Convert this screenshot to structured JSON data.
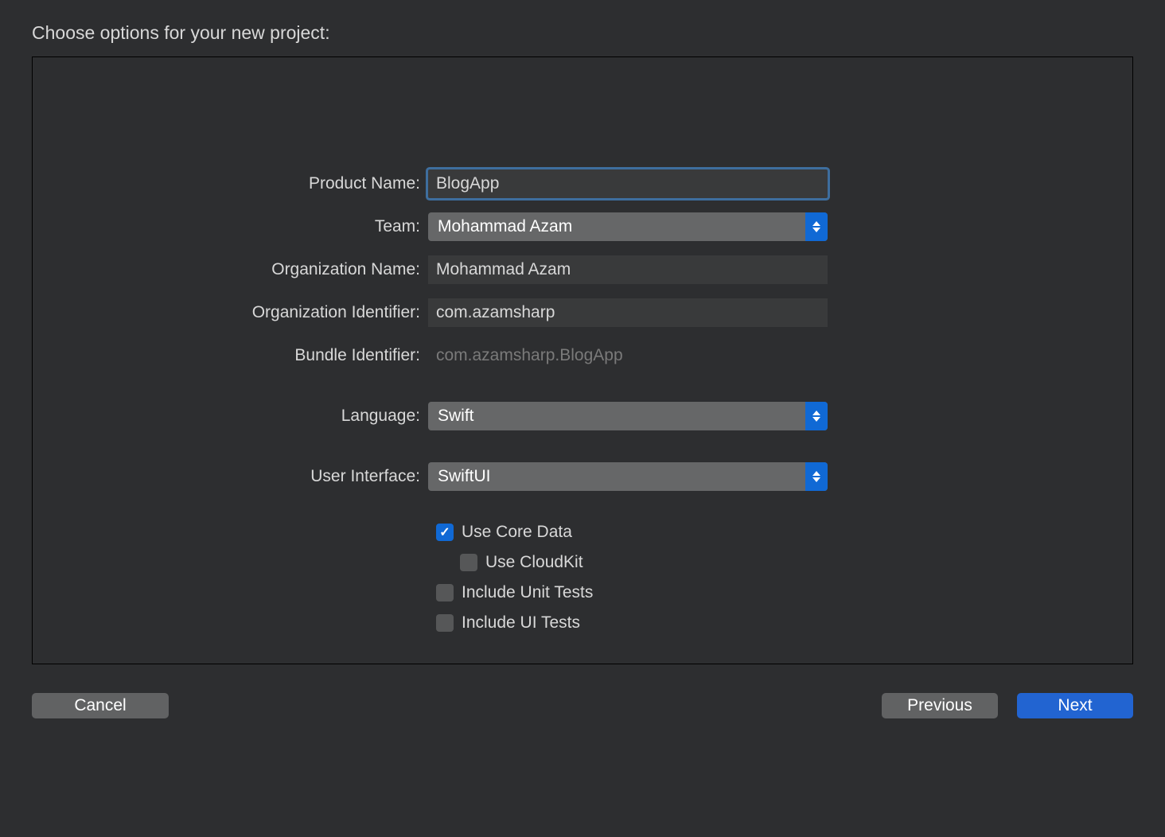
{
  "dialog": {
    "title": "Choose options for your new project:",
    "fields": {
      "productName": {
        "label": "Product Name:",
        "value": "BlogApp"
      },
      "team": {
        "label": "Team:",
        "value": "Mohammad Azam"
      },
      "orgName": {
        "label": "Organization Name:",
        "value": "Mohammad Azam"
      },
      "orgIdentifier": {
        "label": "Organization Identifier:",
        "value": "com.azamsharp"
      },
      "bundleIdentifier": {
        "label": "Bundle Identifier:",
        "value": "com.azamsharp.BlogApp"
      },
      "language": {
        "label": "Language:",
        "value": "Swift"
      },
      "userInterface": {
        "label": "User Interface:",
        "value": "SwiftUI"
      }
    },
    "checkboxes": {
      "useCoreData": {
        "label": "Use Core Data",
        "checked": true
      },
      "useCloudKit": {
        "label": "Use CloudKit",
        "checked": false
      },
      "includeUnitTests": {
        "label": "Include Unit Tests",
        "checked": false
      },
      "includeUITests": {
        "label": "Include UI Tests",
        "checked": false
      }
    },
    "buttons": {
      "cancel": "Cancel",
      "previous": "Previous",
      "next": "Next"
    }
  }
}
